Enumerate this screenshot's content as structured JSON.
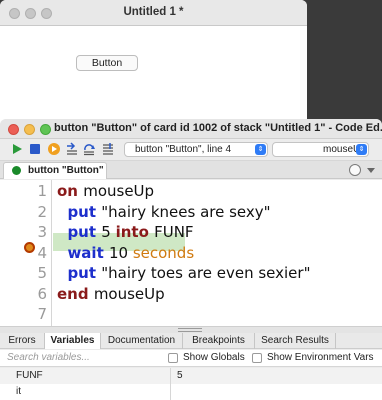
{
  "stack_window": {
    "title": "Untitled 1 *",
    "card_button_label": "Button"
  },
  "editor": {
    "title": "button \"Button\" of card id 1002 of stack \"Untitled 1\" - Code Ed...",
    "toolbar": {
      "object_select": "button \"Button\", line 4",
      "handler_select": "mouseUp"
    },
    "tab": {
      "label": "button \"Button\""
    },
    "code": {
      "line_numbers": [
        "1",
        "2",
        "3",
        "4",
        "5",
        "6",
        "7"
      ],
      "breakpoint_line": "4",
      "lines": [
        {
          "parts": [
            {
              "t": "on ",
              "c": "kw-r"
            },
            {
              "t": "mouseUp",
              "c": "ident"
            }
          ]
        },
        {
          "parts": [
            {
              "t": "  put ",
              "c": "kw-b"
            },
            {
              "t": "\"hairy knees are sexy\"",
              "c": "ident"
            }
          ]
        },
        {
          "parts": [
            {
              "t": "  put ",
              "c": "kw-b"
            },
            {
              "t": "5 ",
              "c": "ident"
            },
            {
              "t": "into ",
              "c": "kw-r"
            },
            {
              "t": "FUNF",
              "c": "ident"
            }
          ]
        },
        {
          "parts": [
            {
              "t": "  wait ",
              "c": "kw-b"
            },
            {
              "t": "10 ",
              "c": "ident"
            },
            {
              "t": "seconds",
              "c": "kw-org"
            }
          ]
        },
        {
          "parts": [
            {
              "t": "  put ",
              "c": "kw-b"
            },
            {
              "t": "\"hairy toes are even sexier\"",
              "c": "ident"
            }
          ]
        },
        {
          "parts": [
            {
              "t": "end ",
              "c": "kw-r"
            },
            {
              "t": "mouseUp",
              "c": "ident"
            }
          ]
        },
        {
          "parts": []
        }
      ]
    },
    "bottom_tabs": [
      "Errors",
      "Variables",
      "Documentation",
      "Breakpoints",
      "Search Results"
    ],
    "active_bottom_tab": "Variables",
    "search_placeholder": "Search variables...",
    "show_globals_label": "Show Globals",
    "show_env_label": "Show Environment Vars",
    "variables": [
      {
        "name": "FUNF",
        "value": "5"
      },
      {
        "name": "it",
        "value": ""
      }
    ]
  },
  "colors": {
    "keyword_red": "#8a1a1a",
    "keyword_blue": "#1d2fcc",
    "keyword_orange": "#d07a10",
    "breakpoint_highlight": "#cfe8c5",
    "traffic_red": "#ec5f56",
    "traffic_yellow": "#f5be4f",
    "traffic_green": "#5fc454"
  },
  "icons": {
    "run": "play-icon",
    "stop": "stop-icon",
    "step_into": "step-into-icon",
    "step_over": "step-over-icon",
    "step_out": "step-out-icon",
    "tab_icon": "script-icon",
    "history": "clock-icon",
    "add_tab": "add-icon"
  }
}
